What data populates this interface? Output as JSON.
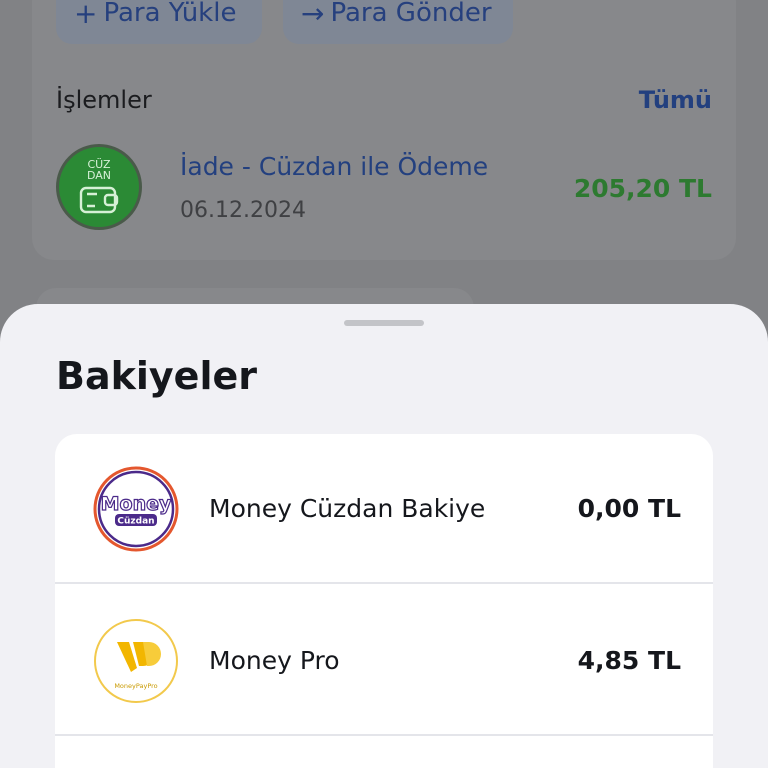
{
  "quick_actions": {
    "load_label": "Para Yükle",
    "send_label": "Para Gönder"
  },
  "transactions": {
    "title": "İşlemler",
    "all_link": "Tümü",
    "items": [
      {
        "name": "İade - Cüzdan ile Ödeme",
        "date": "06.12.2024",
        "amount": "205,20 TL",
        "logo_text": "CÜZ DAN"
      }
    ]
  },
  "balances_sheet": {
    "title": "Bakiyeler",
    "items": [
      {
        "label": "Money Cüzdan Bakiye",
        "value": "0,00 TL",
        "logo_main": "Money",
        "logo_sub": "Cüzdan"
      },
      {
        "label": "Money Pro",
        "value": "4,85 TL",
        "logo_sub": "MoneyPayPro"
      }
    ]
  },
  "colors": {
    "accent_blue": "#23407f",
    "positive_green": "#2d7a30",
    "sheet_bg": "#f1f1f5",
    "money_purple": "#4b2a8a",
    "money_orange": "#e4572e",
    "pro_gold": "#f2b600"
  }
}
